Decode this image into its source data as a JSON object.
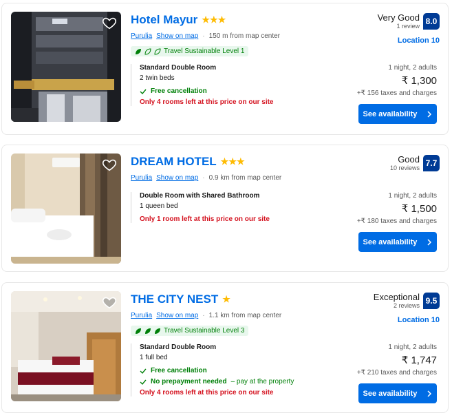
{
  "hotels": [
    {
      "name": "Hotel Mayur",
      "stars": "★★★",
      "city": "Purulia",
      "show_on_map": "Show on map",
      "distance": "150 m from map center",
      "sustainable": "Travel Sustainable Level 1",
      "room_name": "Standard Double Room",
      "beds": "2 twin beds",
      "benefit": "Free cancellation",
      "scarcity": "Only 4 rooms left at this price on our site",
      "review_word": "Very Good",
      "review_count": "1 review",
      "score": "8.0",
      "location": "Location 10",
      "nights": "1 night, 2 adults",
      "price": "₹ 1,300",
      "taxes": "+₹ 156 taxes and charges",
      "cta": "See availability"
    },
    {
      "name": "DREAM HOTEL",
      "stars": "★★★",
      "city": "Purulia",
      "show_on_map": "Show on map",
      "distance": "0.9 km from map center",
      "room_name": "Double Room with Shared Bathroom",
      "beds": "1 queen bed",
      "scarcity": "Only 1 room left at this price on our site",
      "review_word": "Good",
      "review_count": "10 reviews",
      "score": "7.7",
      "nights": "1 night, 2 adults",
      "price": "₹ 1,500",
      "taxes": "+₹ 180 taxes and charges",
      "cta": "See availability"
    },
    {
      "name": "THE CITY NEST",
      "stars": "★",
      "city": "Purulia",
      "show_on_map": "Show on map",
      "distance": "1.1 km from map center",
      "sustainable": "Travel Sustainable Level 3",
      "room_name": "Standard Double Room",
      "beds": "1 full bed",
      "benefit": "Free cancellation",
      "benefit2": "No prepayment needed",
      "benefit2_sub": "– pay at the property",
      "scarcity": "Only 4 rooms left at this price on our site",
      "review_word": "Exceptional",
      "review_count": "2 reviews",
      "score": "9.5",
      "location": "Location 10",
      "nights": "1 night, 2 adults",
      "price": "₹ 1,747",
      "taxes": "+₹ 210 taxes and charges",
      "cta": "See availability"
    }
  ],
  "colors": {
    "link": "#006ce4",
    "score_bg": "#003b95",
    "green": "#008009",
    "red": "#d4111e",
    "star": "#febb02"
  }
}
